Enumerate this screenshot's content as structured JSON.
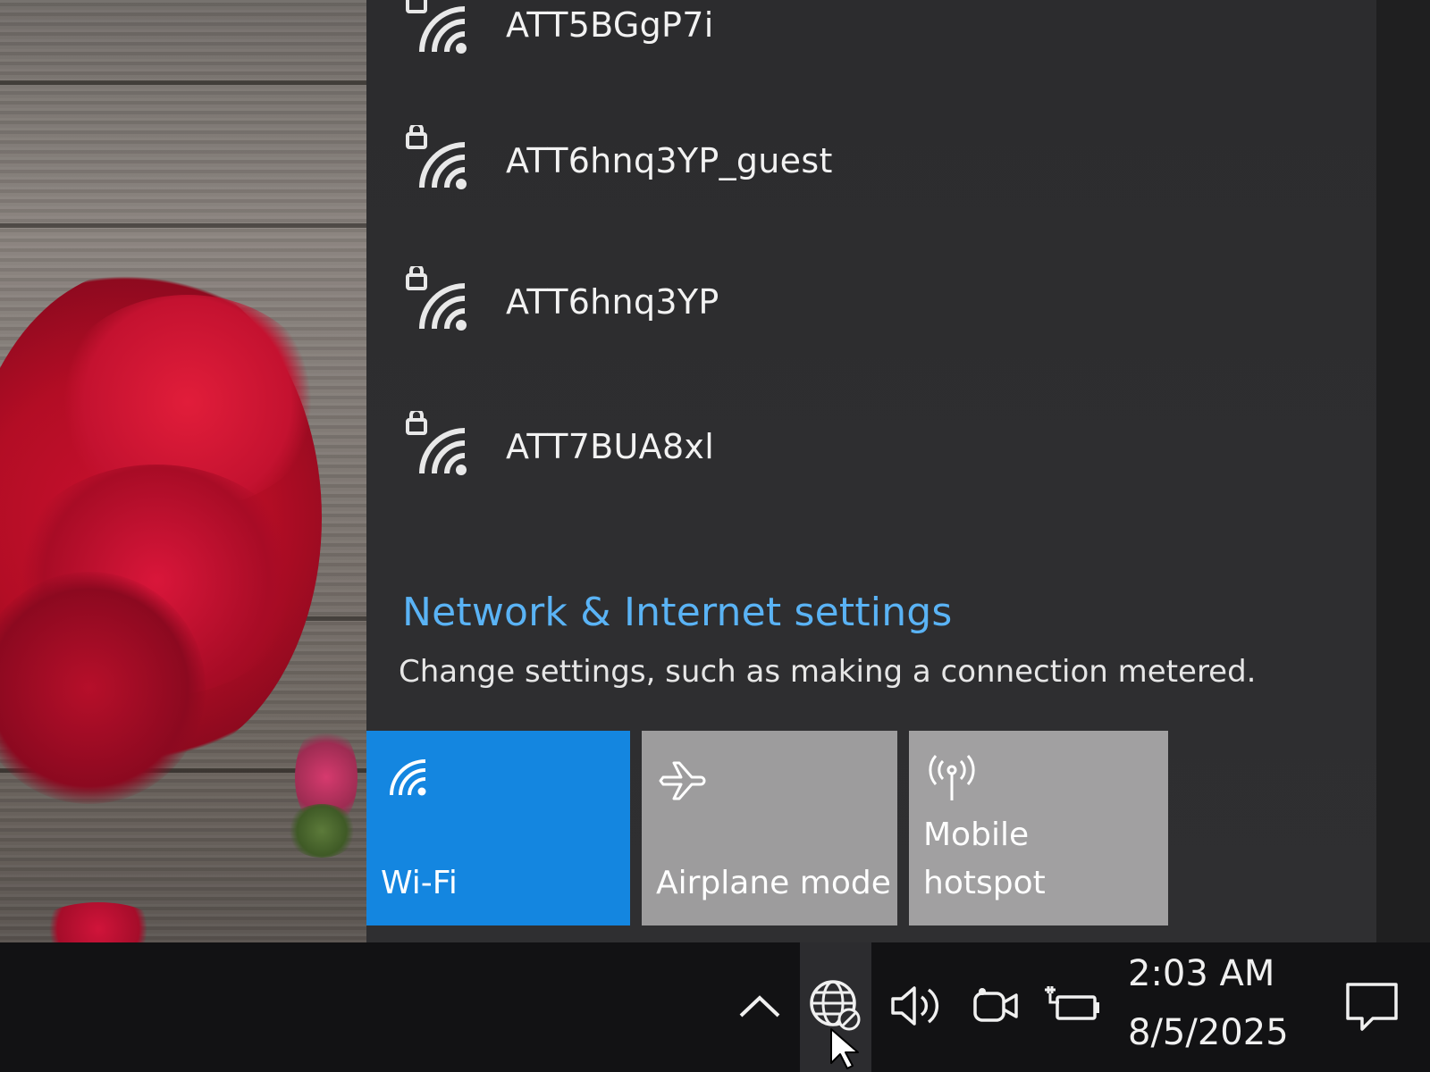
{
  "networks": [
    {
      "ssid": "ATT5BGgP7i",
      "secured": true
    },
    {
      "ssid": "ATT6hnq3YP_guest",
      "secured": true
    },
    {
      "ssid": "ATT6hnq3YP",
      "secured": true
    },
    {
      "ssid": "ATT7BUA8xl",
      "secured": true
    }
  ],
  "settings": {
    "link": "Network & Internet settings",
    "description": "Change settings, such as making a connection metered."
  },
  "quick_actions": [
    {
      "label": "Wi-Fi",
      "icon": "wifi-icon",
      "active": true
    },
    {
      "label": "Airplane mode",
      "icon": "airplane-icon",
      "active": false
    },
    {
      "label": "Mobile\nhotspot",
      "icon": "hotspot-icon",
      "active": false
    }
  ],
  "taskbar": {
    "time": "2:03 AM",
    "date": "8/5/2025",
    "tray_icons": [
      "chevron-up-icon",
      "globe-no-internet-icon",
      "volume-icon",
      "meet-now-icon",
      "battery-charging-icon",
      "notifications-icon"
    ]
  },
  "colors": {
    "accent": "#1486e0",
    "link": "#5ab3f5",
    "flyout_bg": "#2c2c2e",
    "tile_inactive": "#9d9c9d",
    "taskbar_bg": "#121214"
  }
}
